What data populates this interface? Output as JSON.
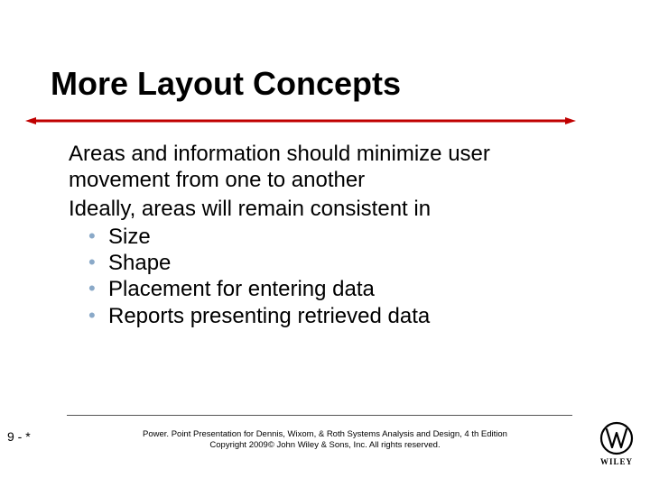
{
  "title": "More Layout Concepts",
  "body": {
    "para1": "Areas and information should minimize user movement from one to another",
    "para2": "Ideally, areas will remain consistent in",
    "items": {
      "a": "Size",
      "b": "Shape",
      "c": "Placement for entering data",
      "d": "Reports presenting retrieved data"
    }
  },
  "footer": {
    "line1": "Power. Point Presentation for Dennis, Wixom, & Roth Systems Analysis and Design, 4 th Edition",
    "line2": "Copyright 2009© John Wiley & Sons, Inc.  All rights reserved."
  },
  "page": "9 - *",
  "colors": {
    "ruleRed": "#c00000",
    "subBullet": "#8aa9c8"
  }
}
